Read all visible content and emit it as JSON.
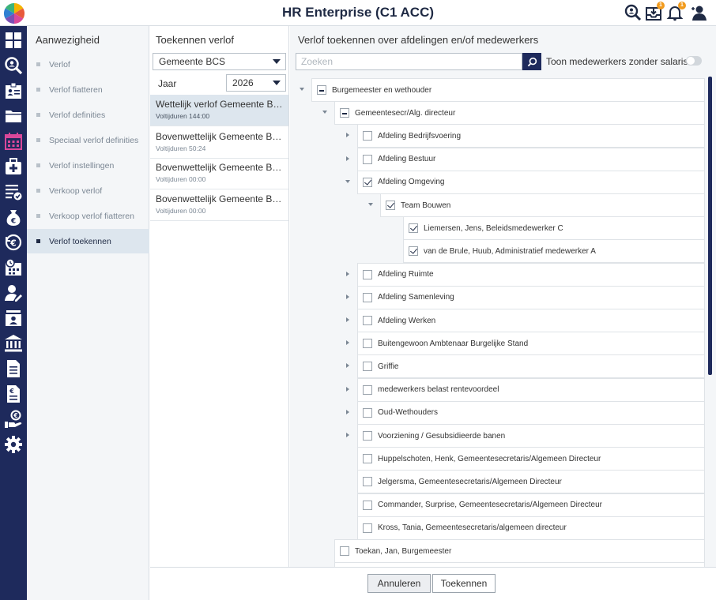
{
  "header": {
    "title": "HR Enterprise (C1 ACC)",
    "badges": {
      "inbox": "1",
      "notifications": "1"
    }
  },
  "rail": {
    "icons": [
      "dashboard-icon",
      "search-person-icon",
      "id-card-icon",
      "folder-icon",
      "calendar-icon",
      "medical-icon",
      "checklist-icon",
      "money-bag-icon",
      "euro-cycle-icon",
      "schedule-icon",
      "user-edit-icon",
      "contact-card-icon",
      "bank-icon",
      "document-icon",
      "invoice-icon",
      "hand-money-icon",
      "gear-icon"
    ],
    "active_color": "#d9489a"
  },
  "submenu": {
    "title": "Aanwezigheid",
    "items": [
      {
        "label": "Verlof"
      },
      {
        "label": "Verlof fiatteren"
      },
      {
        "label": "Verlof definities"
      },
      {
        "label": "Speciaal verlof definities"
      },
      {
        "label": "Verlof instellingen"
      },
      {
        "label": "Verkoop verlof"
      },
      {
        "label": "Verkoop verlof fiatteren"
      },
      {
        "label": "Verlof toekennen"
      }
    ]
  },
  "middle": {
    "title": "Toekennen verlof",
    "organisation": "Gemeente BCS",
    "year_label": "Jaar",
    "year": "2026",
    "leaves": [
      {
        "name": "Wettelijk verlof Gemeente BCS",
        "hours": "Voltijduren 144:00"
      },
      {
        "name": "Bovenwettelijk Gemeente BCS",
        "hours": "Voltijduren 50:24"
      },
      {
        "name": "Bovenwettelijk Gemeente BCS ...",
        "hours": "Voltijduren 00:00"
      },
      {
        "name": "Bovenwettelijk Gemeente BCS ...",
        "hours": "Voltijduren 00:00"
      }
    ]
  },
  "right": {
    "title": "Verlof toekennen over afdelingen en/of medewerkers",
    "search_placeholder": "Zoeken",
    "toggle_label": "Toon medewerkers zonder salaris",
    "tree": [
      {
        "label": "Burgemeester en wethouder",
        "state": "partial",
        "level": 0,
        "expander": "down"
      },
      {
        "label": "Gemeentesecr/Alg. directeur",
        "state": "partial",
        "level": 1,
        "expander": "down"
      },
      {
        "label": "Afdeling Bedrijfsvoering",
        "state": "unchecked",
        "level": 2,
        "expander": "right"
      },
      {
        "label": "Afdeling Bestuur",
        "state": "unchecked",
        "level": 2,
        "expander": "right"
      },
      {
        "label": "Afdeling Omgeving",
        "state": "checked",
        "level": 2,
        "expander": "down"
      },
      {
        "label": "Team Bouwen",
        "state": "checked",
        "level": 3,
        "expander": "down"
      },
      {
        "label": "Liemersen, Jens, Beleidsmedewerker C",
        "state": "checked",
        "level": 4,
        "expander": "none"
      },
      {
        "label": "van de Brule, Huub, Administratief medewerker A",
        "state": "checked",
        "level": 4,
        "expander": "none"
      },
      {
        "label": "Afdeling Ruimte",
        "state": "unchecked",
        "level": 2,
        "expander": "right"
      },
      {
        "label": "Afdeling Samenleving",
        "state": "unchecked",
        "level": 2,
        "expander": "right"
      },
      {
        "label": "Afdeling Werken",
        "state": "unchecked",
        "level": 2,
        "expander": "right"
      },
      {
        "label": "Buitengewoon Ambtenaar Burgelijke Stand",
        "state": "unchecked",
        "level": 2,
        "expander": "right"
      },
      {
        "label": "Griffie",
        "state": "unchecked",
        "level": 2,
        "expander": "right"
      },
      {
        "label": "medewerkers belast rentevoordeel",
        "state": "unchecked",
        "level": 2,
        "expander": "right"
      },
      {
        "label": "Oud-Wethouders",
        "state": "unchecked",
        "level": 2,
        "expander": "right"
      },
      {
        "label": "Voorziening / Gesubsidieerde banen",
        "state": "unchecked",
        "level": 2,
        "expander": "right"
      },
      {
        "label": "Huppelschoten, Henk, Gemeentesecretaris/Algemeen Directeur",
        "state": "unchecked",
        "level": 2,
        "expander": "none"
      },
      {
        "label": "Jelgersma, Gemeentesecretaris/Algemeen Directeur",
        "state": "unchecked",
        "level": 2,
        "expander": "none"
      },
      {
        "label": "Commander, Surprise, Gemeentesecretaris/Algemeen Directeur",
        "state": "unchecked",
        "level": 2,
        "expander": "none"
      },
      {
        "label": "Kross, Tania, Gemeentesecretaris/algemeen directeur",
        "state": "unchecked",
        "level": 2,
        "expander": "none"
      },
      {
        "label": "Toekan, Jan, Burgemeester",
        "state": "unchecked",
        "level": 1,
        "expander": "none"
      },
      {
        "label": "",
        "state": "unchecked",
        "level": 1,
        "expander": "none"
      }
    ]
  },
  "footer": {
    "cancel_label": "Annuleren",
    "grant_label": "Toekennen"
  }
}
